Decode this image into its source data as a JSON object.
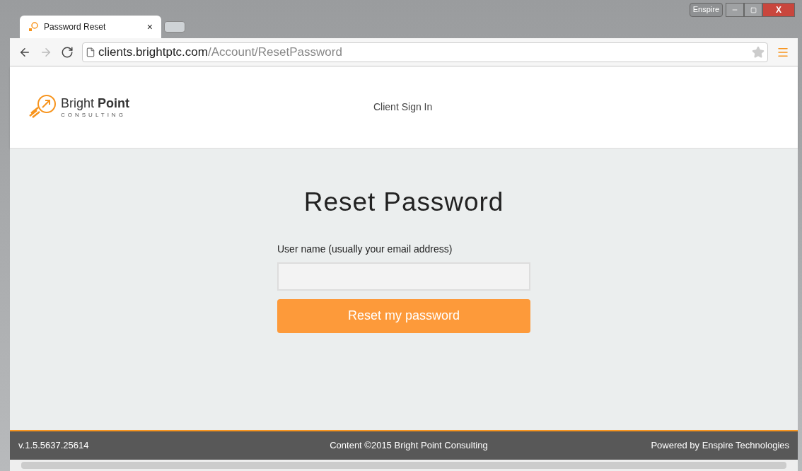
{
  "browser": {
    "tab_title": "Password Reset",
    "tab_close": "×",
    "profile": "Enspire",
    "close": "X",
    "url_host": "clients.brightptc.com",
    "url_path": "/Account/ResetPassword"
  },
  "header": {
    "logo_name_light": "Bright",
    "logo_name_bold": "Point",
    "logo_sub": "CONSULTING",
    "nav_link": "Client Sign In"
  },
  "form": {
    "title": "Reset Password",
    "field_label": "User name (usually your email address)",
    "button": "Reset my password"
  },
  "footer": {
    "version": "v.1.5.5637.25614",
    "copyright": "Content ©2015 Bright Point Consulting",
    "powered": "Powered by Enspire Technologies"
  }
}
